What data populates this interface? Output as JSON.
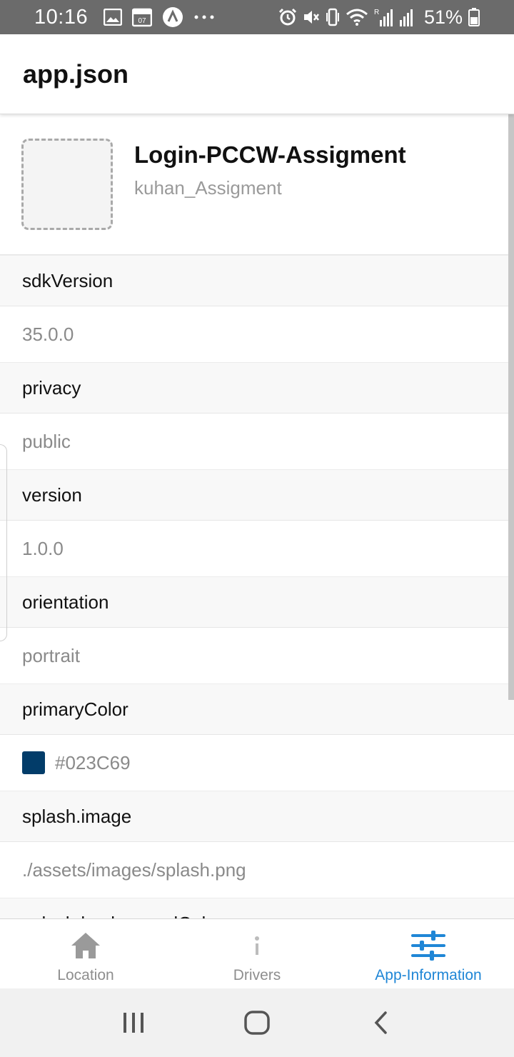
{
  "status_bar": {
    "time": "10:16",
    "battery": "51%",
    "left_icons": [
      "image-icon",
      "calendar-icon",
      "app-a-icon",
      "more-icon"
    ],
    "right_icons": [
      "alarm-icon",
      "mute-icon",
      "vibrate-icon",
      "wifi-icon",
      "signal-r-icon",
      "signal-icon",
      "battery-icon"
    ]
  },
  "header": {
    "title": "app.json"
  },
  "app": {
    "name": "Login-PCCW-Assigment",
    "slug": "kuhan_Assigment"
  },
  "sections": [
    {
      "title": "sdkVersion",
      "value": "35.0.0"
    },
    {
      "title": "privacy",
      "value": "public"
    },
    {
      "title": "version",
      "value": "1.0.0"
    },
    {
      "title": "orientation",
      "value": "portrait"
    },
    {
      "title": "primaryColor",
      "value": "#023C69",
      "swatch": "#023C69"
    },
    {
      "title": "splash.image",
      "value": "./assets/images/splash.png"
    },
    {
      "title": "splash.backgroundColor",
      "value": ""
    }
  ],
  "tabs": [
    {
      "label": "Location",
      "icon": "home-icon",
      "active": false
    },
    {
      "label": "Drivers",
      "icon": "info-icon",
      "active": false
    },
    {
      "label": "App-Information",
      "icon": "sliders-icon",
      "active": true
    }
  ],
  "colors": {
    "accent": "#1f86d6",
    "inactive": "#8e8e8e",
    "status_bar": "#6b6b6b"
  }
}
